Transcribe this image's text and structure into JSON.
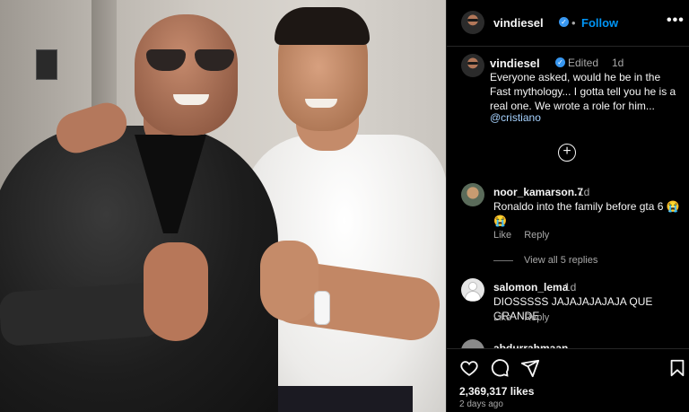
{
  "post": {
    "photo_alt": "Two men posing with thumbs up",
    "author": "vindiesel",
    "follow_label": "Follow",
    "header_separator": "•",
    "more_label": "•••"
  },
  "caption": {
    "username": "vindiesel",
    "edited_label": "Edited",
    "separator": "•",
    "time": "1d",
    "text": "Everyone asked, would he be in the Fast mythology... I gotta tell you he is a real one.  We wrote a role for him...",
    "mention": "@cristiano"
  },
  "load_more_label": "+",
  "comments": [
    {
      "username": "noor_kamarson.7",
      "time": "1d",
      "text": "Ronaldo into the family before gta 6 😭😭",
      "like_label": "Like",
      "reply_label": "Reply",
      "view_replies_label": "View all 5 replies"
    },
    {
      "username": "salomon_lema",
      "time": "1d",
      "text": "DIOSSSSS JAJAJAJAJAJA QUE GRANDE",
      "like_label": "Like",
      "reply_label": "Reply"
    },
    {
      "username": "abdurrahmaan"
    }
  ],
  "footer": {
    "likes": "2,369,317 likes",
    "posted": "2 days ago"
  },
  "icons": {
    "heart": "heart-icon",
    "comment": "comment-icon",
    "share": "share-icon",
    "save": "bookmark-icon",
    "verified": "verified-badge-icon"
  },
  "colors": {
    "background": "#000000",
    "link": "#0095f6",
    "verified": "#3897f0",
    "muted": "#a8a8a8"
  }
}
